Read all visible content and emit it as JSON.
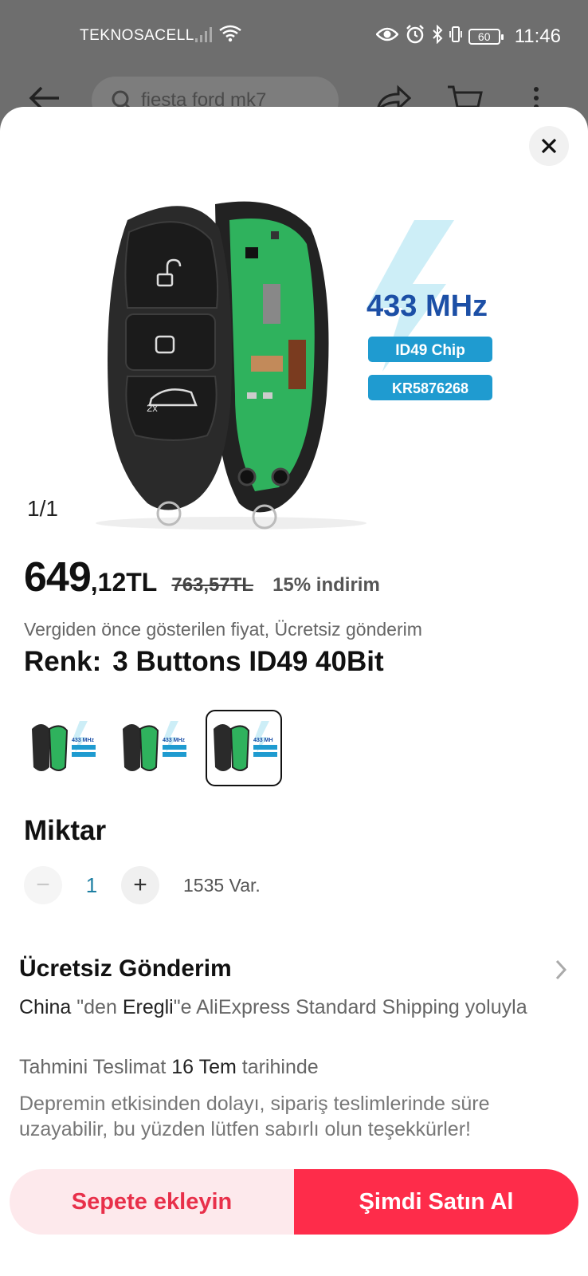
{
  "status_bar": {
    "carrier": "TEKNOSACELL",
    "battery": "60",
    "time": "11:46"
  },
  "background_header": {
    "search_text": "fiesta ford mk7"
  },
  "product_image": {
    "frequency": "433 MHz",
    "chip": "ID49 Chip",
    "model": "KR5876268",
    "counter": "1/1"
  },
  "price": {
    "integer": "649",
    "decimal": ",12TL",
    "original": "763,57TL",
    "discount": "15% indirim"
  },
  "tax_note": "Vergiden önce gösterilen fiyat, Ücretsiz gönderim",
  "color": {
    "label": "Renk:",
    "value": "3 Buttons ID49 40Bit"
  },
  "variants": [
    {
      "frequency": "433 MHz",
      "selected": false
    },
    {
      "frequency": "433 MHz",
      "selected": false
    },
    {
      "frequency": "433 MH",
      "selected": true
    }
  ],
  "quantity": {
    "title": "Miktar",
    "minus": "−",
    "value": "1",
    "plus": "+",
    "stock": "1535 Var."
  },
  "shipping": {
    "title": "Ücretsiz Gönderim",
    "from": "China",
    "route_mid": " \"den ",
    "to": "Eregli",
    "route_end": "\"e AliExpress Standard Shipping yoluyla",
    "eta_prefix": "Tahmini Teslimat ",
    "eta_date": "16 Tem",
    "eta_suffix": " tarihinde",
    "note": "Depremin etkisinden dolayı, sipariş teslimlerinde süre uzayabilir, bu yüzden lütfen sabırlı olun teşekkürler!"
  },
  "actions": {
    "add_to_cart": "Sepete ekleyin",
    "buy_now": "Şimdi Satın Al"
  },
  "colors": {
    "accent": "#fe2c4a",
    "accent_light": "#fde9ec",
    "pcb_green": "#2fb25d",
    "chip_blue": "#1f9bd0",
    "freq_blue": "#1c4fa6"
  }
}
